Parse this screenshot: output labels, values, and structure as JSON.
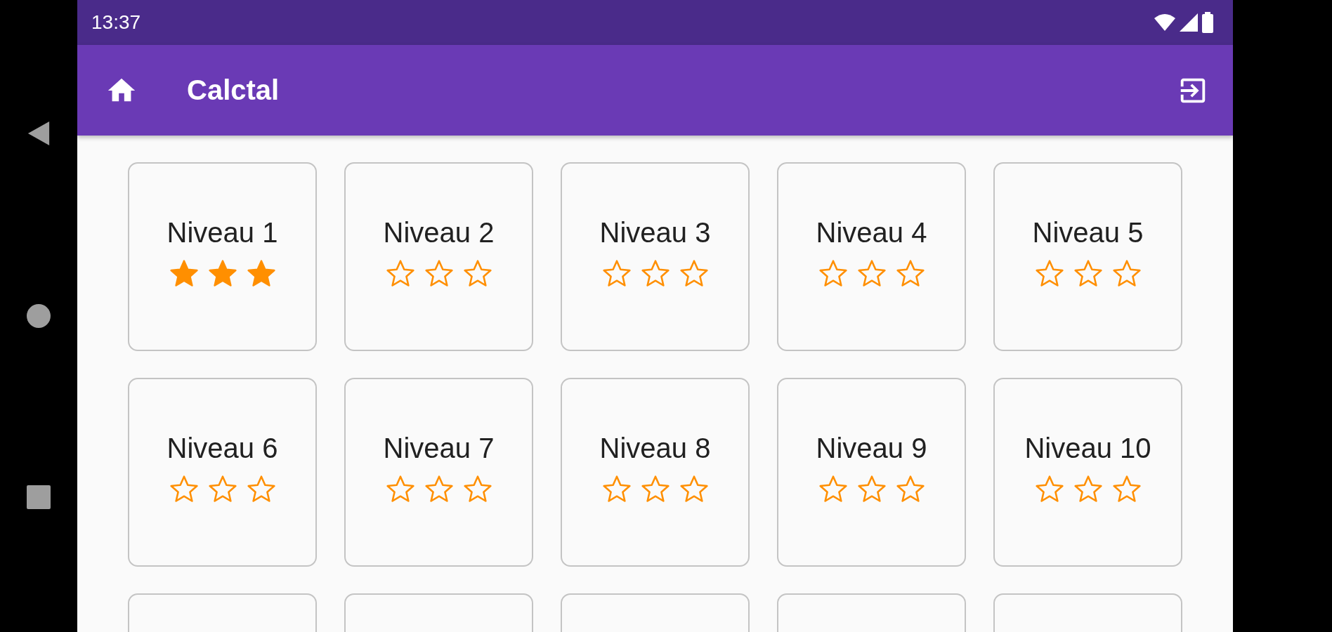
{
  "status_bar": {
    "time": "13:37"
  },
  "app_bar": {
    "title": "Calctal"
  },
  "levels": [
    {
      "label": "Niveau 1",
      "stars": 3
    },
    {
      "label": "Niveau 2",
      "stars": 0
    },
    {
      "label": "Niveau 3",
      "stars": 0
    },
    {
      "label": "Niveau 4",
      "stars": 0
    },
    {
      "label": "Niveau 5",
      "stars": 0
    },
    {
      "label": "Niveau 6",
      "stars": 0
    },
    {
      "label": "Niveau 7",
      "stars": 0
    },
    {
      "label": "Niveau 8",
      "stars": 0
    },
    {
      "label": "Niveau 9",
      "stars": 0
    },
    {
      "label": "Niveau 10",
      "stars": 0
    }
  ]
}
